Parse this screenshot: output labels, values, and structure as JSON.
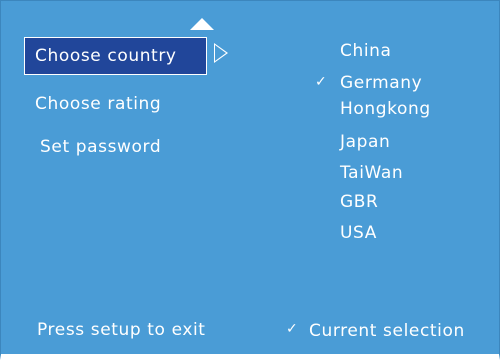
{
  "menu": {
    "items": [
      {
        "label": "Choose country"
      },
      {
        "label": "Choose rating"
      },
      {
        "label": "Set password"
      }
    ]
  },
  "countries": [
    {
      "label": "China",
      "checked": false
    },
    {
      "label": "Germany",
      "checked": true
    },
    {
      "label": "Hongkong",
      "checked": false
    },
    {
      "label": "Japan",
      "checked": false
    },
    {
      "label": "TaiWan",
      "checked": false
    },
    {
      "label": "GBR",
      "checked": false
    },
    {
      "label": "USA",
      "checked": false
    }
  ],
  "footer": {
    "exit_hint": "Press setup to exit",
    "check_glyph": "✓",
    "legend_label": "Current selection"
  },
  "colors": {
    "background": "#4a9cd6",
    "highlight": "#21469a",
    "text": "#ffffff"
  }
}
